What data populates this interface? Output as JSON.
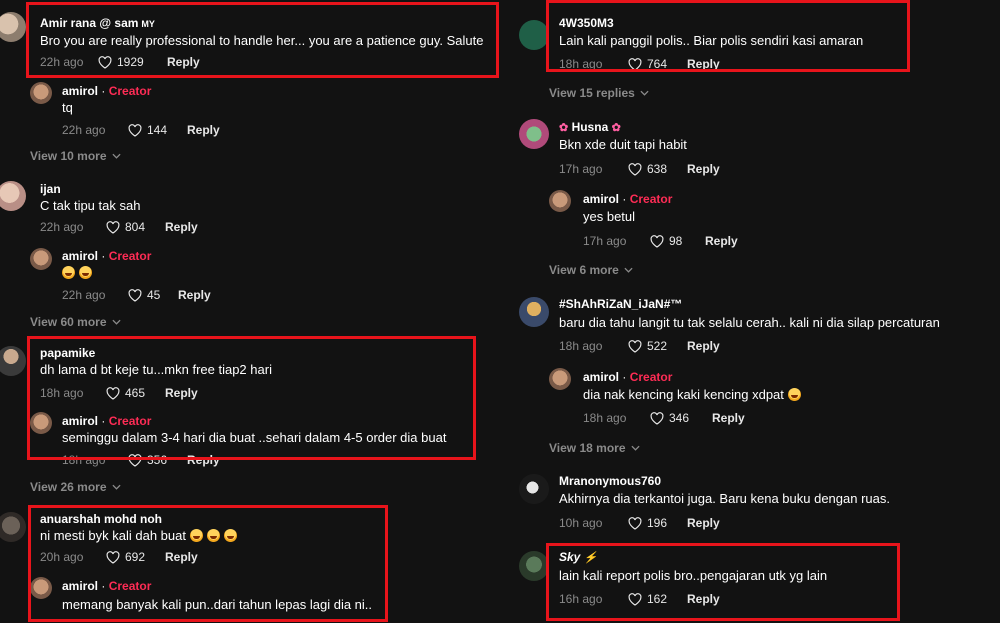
{
  "icons": {
    "like": "heart-outline-icon",
    "expand": "chevron-down-icon"
  },
  "colors": {
    "background": "#121212",
    "creator": "#fe2c55",
    "highlight": "#e8141b",
    "muted": "#8a8a8a"
  },
  "left": {
    "c1": {
      "user": "Amir rana @ sam",
      "badge": "MY",
      "text": "Bro you are really professional to handle her... you are a patience guy. Salute",
      "time": "22h ago",
      "likes": "1929",
      "reply": "Reply"
    },
    "r1": {
      "user": "amirol",
      "sep": " · ",
      "creator": "Creator",
      "text": "tq",
      "time": "22h ago",
      "likes": "144",
      "reply": "Reply"
    },
    "vm1": "View 10 more",
    "c2": {
      "user": "ijan",
      "text": "C tak tipu tak sah",
      "time": "22h ago",
      "likes": "804",
      "reply": "Reply"
    },
    "r2": {
      "user": "amirol",
      "sep": " · ",
      "creator": "Creator",
      "time": "22h ago",
      "likes": "45",
      "reply": "Reply"
    },
    "vm2": "View 60 more",
    "c3": {
      "user": "papamike",
      "text": "dh lama d bt keje tu...mkn free tiap2 hari",
      "time": "18h ago",
      "likes": "465",
      "reply": "Reply"
    },
    "r3": {
      "user": "amirol",
      "sep": " · ",
      "creator": "Creator",
      "text": "seminggu dalam 3-4 hari dia buat ..sehari dalam 4-5 order dia buat",
      "time": "18h ago",
      "likes": "356",
      "reply": "Reply"
    },
    "vm3": "View 26 more",
    "c4": {
      "user": "anuarshah mohd noh",
      "text": "ni mesti byk kali dah buat",
      "time": "20h ago",
      "likes": "692",
      "reply": "Reply"
    },
    "r4": {
      "user": "amirol",
      "sep": " · ",
      "creator": "Creator",
      "text": "memang banyak kali pun..dari tahun lepas lagi dia ni.."
    }
  },
  "right": {
    "c1": {
      "user": "4W350M3",
      "text": "Lain kali panggil polis.. Biar polis sendiri kasi amaran",
      "time": "18h ago",
      "likes": "764",
      "reply": "Reply"
    },
    "vm1": "View 15 replies",
    "c2": {
      "user": "Husna",
      "text": "Bkn xde duit tapi habit",
      "time": "17h ago",
      "likes": "638",
      "reply": "Reply"
    },
    "r2": {
      "user": "amirol",
      "sep": " · ",
      "creator": "Creator",
      "text": "yes betul",
      "time": "17h ago",
      "likes": "98",
      "reply": "Reply"
    },
    "vm2": "View 6 more",
    "c3": {
      "user": "#ShAhRiZaN_iJaN#™",
      "text": "baru dia tahu langit tu tak selalu cerah.. kali ni dia silap percaturan",
      "time": "18h ago",
      "likes": "522",
      "reply": "Reply"
    },
    "r3": {
      "user": "amirol",
      "sep": " · ",
      "creator": "Creator",
      "text": "dia nak kencing kaki kencing xdpat",
      "time": "18h ago",
      "likes": "346",
      "reply": "Reply"
    },
    "vm3": "View 18 more",
    "c4": {
      "user": "Mranonymous760",
      "text": "Akhirnya dia terkantoi juga. Baru kena buku dengan ruas.",
      "time": "10h ago",
      "likes": "196",
      "reply": "Reply"
    },
    "c5": {
      "user": "Sky",
      "text": "lain kali report polis bro..pengajaran utk yg lain",
      "time": "16h ago",
      "likes": "162",
      "reply": "Reply"
    }
  }
}
